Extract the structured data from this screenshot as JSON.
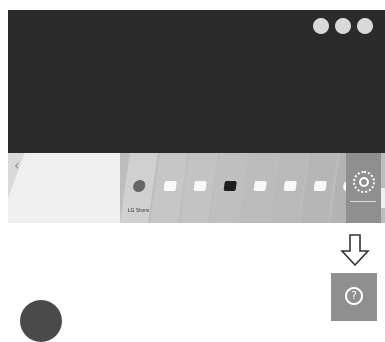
{
  "window": {
    "title": ""
  },
  "top_dots": [
    "",
    "",
    ""
  ],
  "launcher": {
    "left_label": "",
    "apps": [
      {
        "icon": "lg-store-icon",
        "label": "LG Store",
        "dark": false,
        "round": true
      },
      {
        "icon": "app-icon-2",
        "label": "",
        "dark": false
      },
      {
        "icon": "app-icon-3",
        "label": "",
        "dark": false
      },
      {
        "icon": "app-icon-4",
        "label": "",
        "dark": true
      },
      {
        "icon": "app-icon-5",
        "label": "",
        "dark": false
      },
      {
        "icon": "app-icon-6",
        "label": "",
        "dark": false
      },
      {
        "icon": "app-icon-7",
        "label": "",
        "dark": false
      },
      {
        "icon": "app-icon-8",
        "label": "",
        "dark": false
      }
    ]
  },
  "colors": {
    "screen_bg": "#2b2b2b",
    "launcher_bg": "#f2f2f2",
    "apps_bg": "#bdbdbd",
    "selected_bg": "#8f8f8f"
  },
  "icons": {
    "chevron_left": "‹",
    "chevron_right": "›",
    "help": "?"
  }
}
